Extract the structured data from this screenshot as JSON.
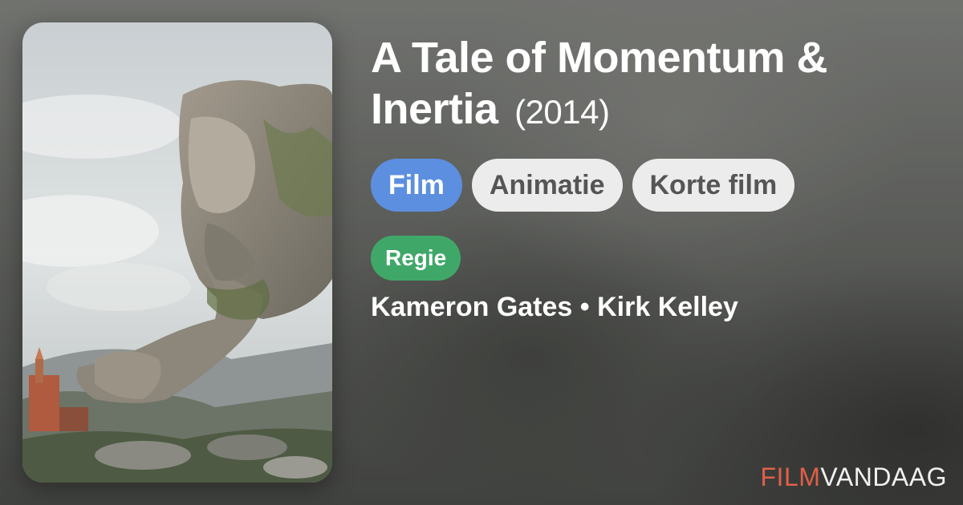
{
  "movie": {
    "title": "A Tale of Momentum & Inertia",
    "year": "(2014)"
  },
  "genres": [
    "Film",
    "Animatie",
    "Korte film"
  ],
  "role": "Regie",
  "directors": "Kameron Gates • Kirk Kelley",
  "brand": {
    "part1": "FILM",
    "part2": "VANDAAG"
  },
  "colors": {
    "chip_primary": "#5d8fe0",
    "chip_default": "#ececec",
    "role_badge": "#3fa869",
    "brand_accent": "#e06048"
  }
}
